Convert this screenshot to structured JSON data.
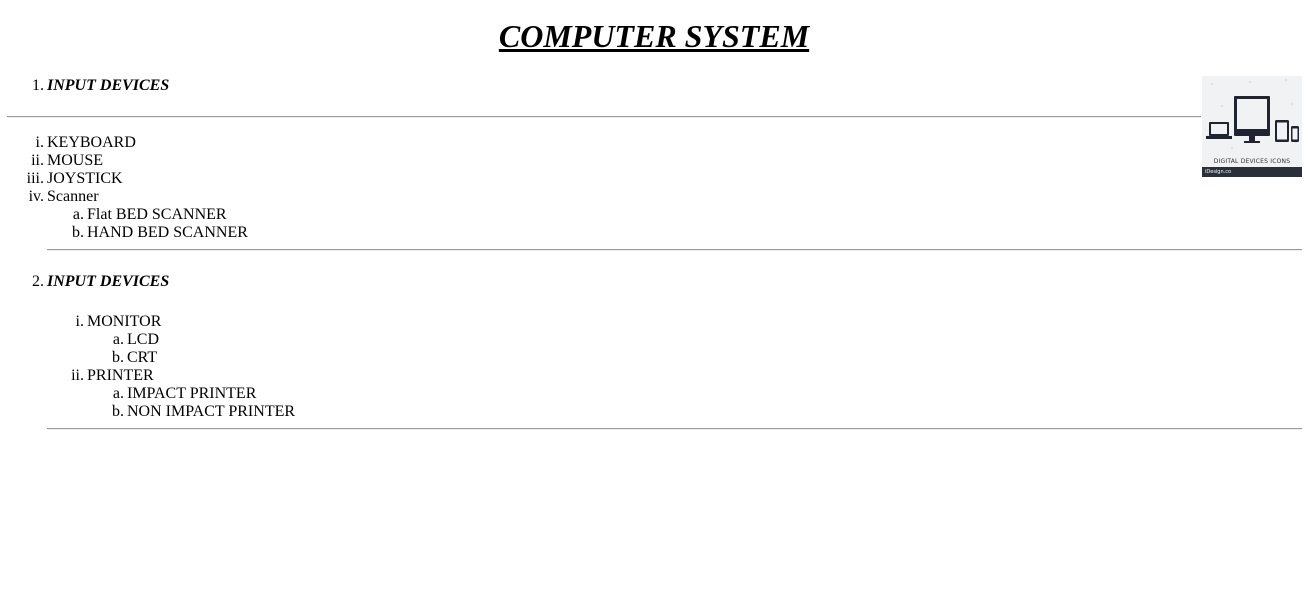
{
  "title": "COMPUTER SYSTEM",
  "sections": [
    {
      "number": "1.",
      "heading": "INPUT DEVICES",
      "items": [
        {
          "marker": "i.",
          "label": "KEYBOARD"
        },
        {
          "marker": "ii.",
          "label": "MOUSE"
        },
        {
          "marker": "iii.",
          "label": "JOYSTICK"
        },
        {
          "marker": "iv.",
          "label": "Scanner",
          "subitems": [
            {
              "marker": "a.",
              "label": "Flat BED SCANNER"
            },
            {
              "marker": "b.",
              "label": "HAND BED SCANNER"
            }
          ]
        }
      ]
    },
    {
      "number": "2.",
      "heading": "INPUT DEVICES",
      "items": [
        {
          "marker": "i.",
          "label": "MONITOR",
          "subitems": [
            {
              "marker": "a.",
              "label": "LCD"
            },
            {
              "marker": "b.",
              "label": "CRT"
            }
          ]
        },
        {
          "marker": "ii.",
          "label": "PRINTER",
          "subitems": [
            {
              "marker": "a.",
              "label": "IMPACT PRINTER"
            },
            {
              "marker": "b.",
              "label": "NON IMPACT PRINTER"
            }
          ]
        }
      ]
    }
  ],
  "image": {
    "icon": "digital-devices-icon",
    "caption": "DIGITAL DEVICES ICONS",
    "brand": "iDesign.co"
  }
}
